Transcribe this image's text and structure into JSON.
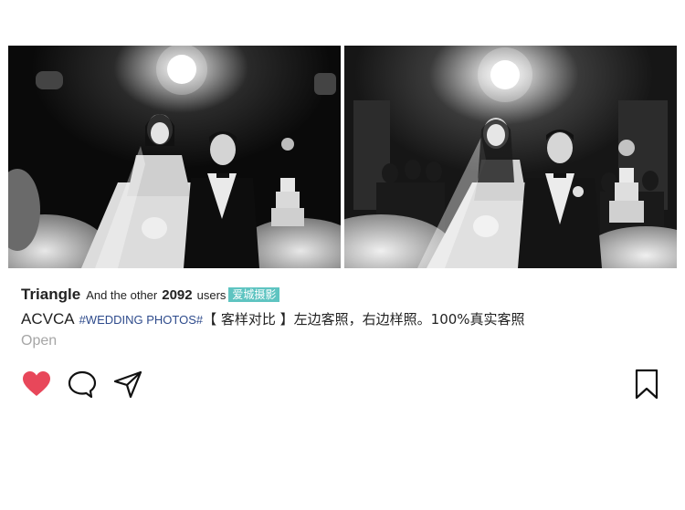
{
  "post": {
    "username": "Triangle",
    "and_other": "And the other",
    "user_count": "2092",
    "users_word": "users",
    "brand_tag": "爱城摄影",
    "brand_name": "ACVCA",
    "hashtag": "#WEDDING PHOTOS#",
    "text": "【 客样对比 】左边客照，右边样照。100%真实客照",
    "open_label": "Open"
  },
  "photos": [
    {
      "name": "client-photo",
      "side": "left"
    },
    {
      "name": "sample-photo",
      "side": "right"
    }
  ],
  "icons": {
    "like": "heart-icon",
    "comment": "comment-icon",
    "share": "send-icon",
    "save": "bookmark-icon"
  },
  "colors": {
    "like": "#e8475a",
    "brand_tag_bg": "#5ec4c1",
    "hashtag": "#2e4b8c",
    "open_text": "#a6a6a6"
  }
}
